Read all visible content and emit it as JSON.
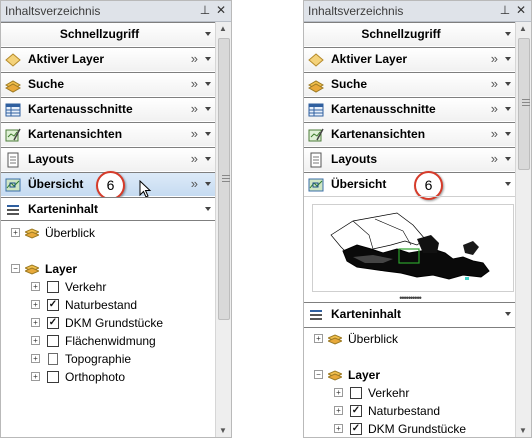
{
  "left_panel": {
    "title": "Inhaltsverzeichnis",
    "sections": [
      {
        "label": "Schnellzugriff"
      },
      {
        "label": "Aktiver Layer",
        "chevron": "»"
      },
      {
        "label": "Suche",
        "chevron": "»"
      },
      {
        "label": "Kartenausschnitte",
        "chevron": "»"
      },
      {
        "label": "Kartenansichten",
        "chevron": "»"
      },
      {
        "label": "Layouts",
        "chevron": "»"
      },
      {
        "label": "Übersicht",
        "chevron": "»",
        "badge": "6"
      },
      {
        "label": "Karteninhalt"
      }
    ],
    "tree": {
      "overview": "Überblick",
      "layer_group": "Layer",
      "items": [
        {
          "label": "Verkehr",
          "checked": false
        },
        {
          "label": "Naturbestand",
          "checked": true
        },
        {
          "label": "DKM Grundstücke",
          "checked": true
        },
        {
          "label": "Flächenwidmung",
          "checked": false
        },
        {
          "label": "Topographie",
          "checked": false
        },
        {
          "label": "Orthophoto",
          "checked": false
        }
      ]
    }
  },
  "right_panel": {
    "title": "Inhaltsverzeichnis",
    "sections": [
      {
        "label": "Schnellzugriff"
      },
      {
        "label": "Aktiver Layer",
        "chevron": "»"
      },
      {
        "label": "Suche",
        "chevron": "»"
      },
      {
        "label": "Kartenausschnitte",
        "chevron": "»"
      },
      {
        "label": "Kartenansichten",
        "chevron": "»"
      },
      {
        "label": "Layouts",
        "chevron": "»"
      },
      {
        "label": "Übersicht",
        "badge": "6"
      },
      {
        "label": "Karteninhalt"
      }
    ],
    "tree": {
      "overview": "Überblick",
      "layer_group": "Layer",
      "items": [
        {
          "label": "Verkehr",
          "checked": false
        },
        {
          "label": "Naturbestand",
          "checked": true
        },
        {
          "label": "DKM Grundstücke",
          "checked": true
        }
      ]
    },
    "splitter": "••••••••••"
  },
  "symbols": {
    "pin": "ᵖ",
    "close": "✕",
    "plus": "+",
    "minus": "−",
    "check": "✓",
    "scroll_up": "▲",
    "scroll_down": "▼"
  },
  "colors": {
    "hover": "#c6dbf1",
    "badge_ring": "#d63b2a",
    "titlebar": "#dfe3e9"
  }
}
